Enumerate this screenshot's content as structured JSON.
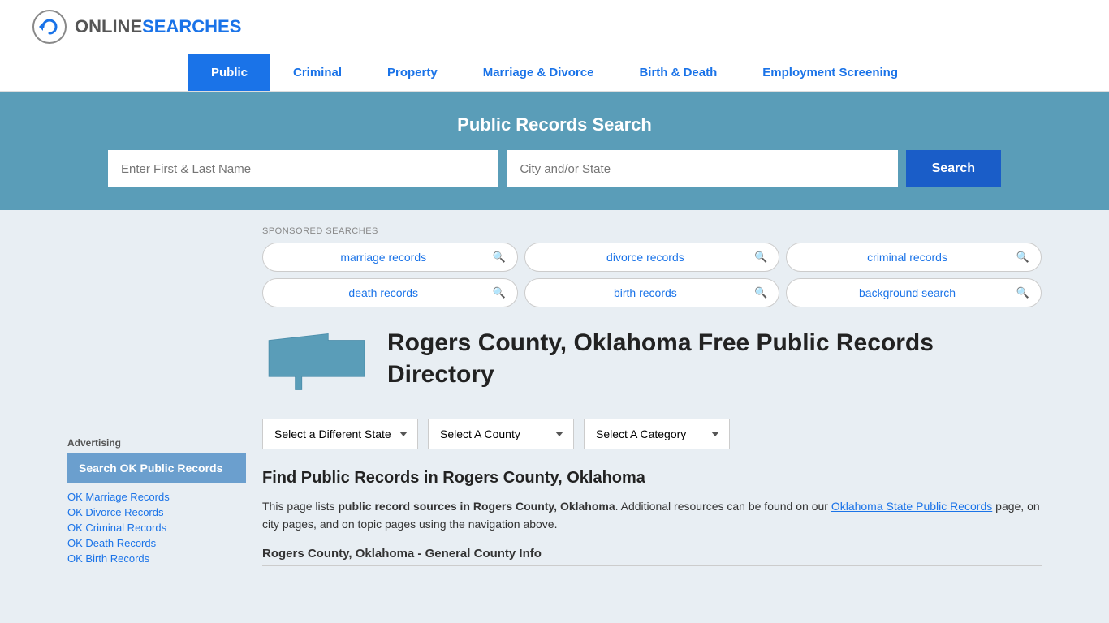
{
  "site": {
    "logo_online": "ONLINE",
    "logo_searches": "SEARCHES"
  },
  "nav": {
    "items": [
      {
        "label": "Public",
        "active": true
      },
      {
        "label": "Criminal",
        "active": false
      },
      {
        "label": "Property",
        "active": false
      },
      {
        "label": "Marriage & Divorce",
        "active": false
      },
      {
        "label": "Birth & Death",
        "active": false
      },
      {
        "label": "Employment Screening",
        "active": false
      }
    ]
  },
  "search_banner": {
    "title": "Public Records Search",
    "name_placeholder": "Enter First & Last Name",
    "city_placeholder": "City and/or State",
    "button_label": "Search"
  },
  "sponsored": {
    "label": "SPONSORED SEARCHES",
    "items": [
      {
        "label": "marriage records"
      },
      {
        "label": "divorce records"
      },
      {
        "label": "criminal records"
      },
      {
        "label": "death records"
      },
      {
        "label": "birth records"
      },
      {
        "label": "background search"
      }
    ]
  },
  "county": {
    "title": "Rogers County, Oklahoma Free Public Records Directory"
  },
  "dropdowns": {
    "state_label": "Select a Different State",
    "county_label": "Select A County",
    "category_label": "Select A Category"
  },
  "find_records": {
    "title": "Find Public Records in Rogers County, Oklahoma",
    "description_part1": "This page lists ",
    "description_bold": "public record sources in Rogers County, Oklahoma",
    "description_part2": ". Additional resources can be found on our ",
    "link_label": "Oklahoma State Public Records",
    "description_part3": " page, on city pages, and on topic pages using the navigation above."
  },
  "county_info_title": "Rogers County, Oklahoma - General County Info",
  "advertising": {
    "label": "Advertising",
    "ad_box_label": "Search OK Public Records",
    "links": [
      "OK Marriage Records",
      "OK Divorce Records",
      "OK Criminal Records",
      "OK Death Records",
      "OK Birth Records"
    ]
  }
}
